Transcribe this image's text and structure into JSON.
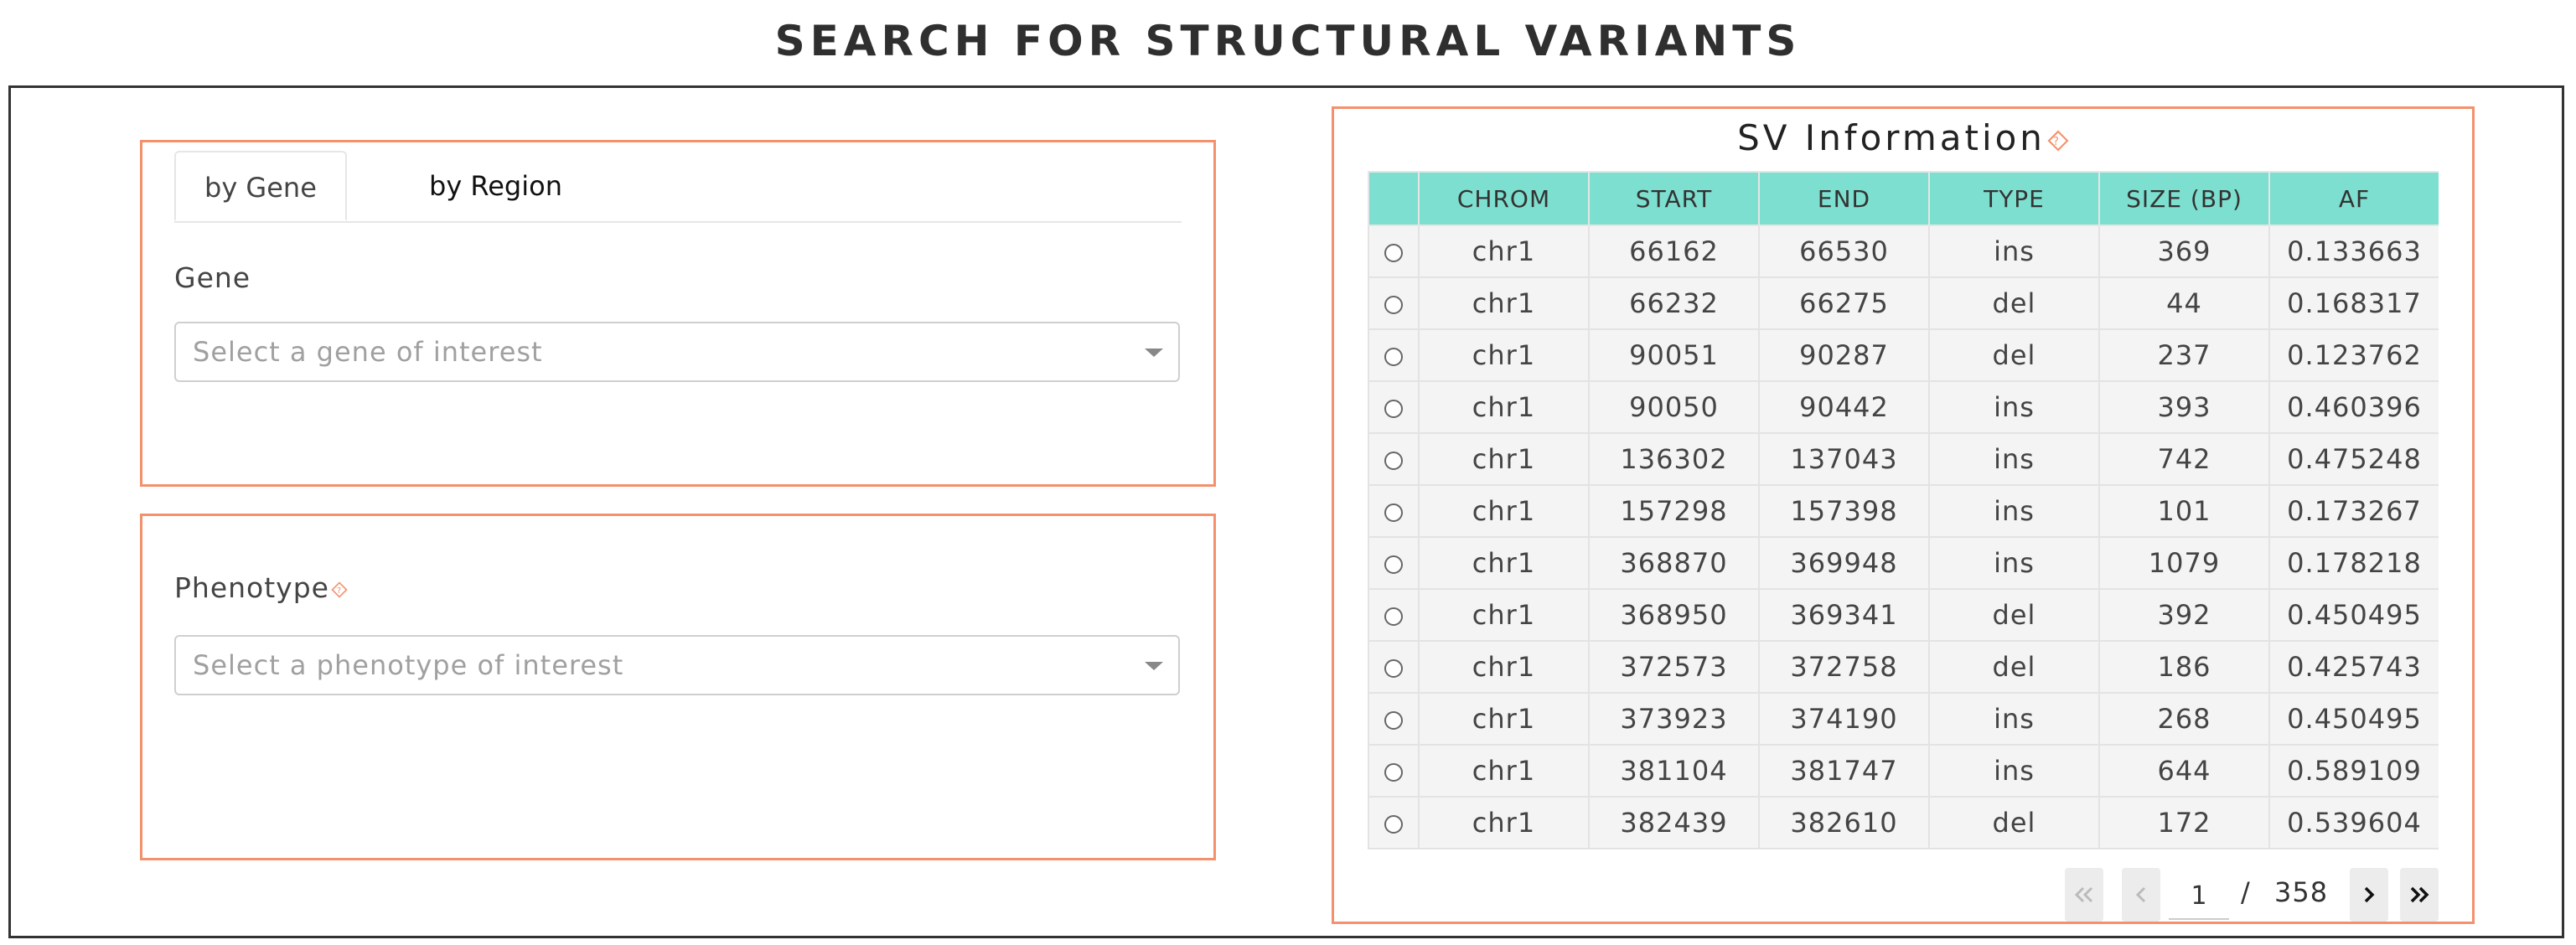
{
  "page": {
    "title": "SEARCH FOR STRUCTURAL VARIANTS"
  },
  "search": {
    "tabs": [
      {
        "label": "by Gene",
        "active": true
      },
      {
        "label": "by Region",
        "active": false
      }
    ],
    "gene_label": "Gene",
    "gene_placeholder": "Select a gene of interest",
    "phenotype_label": "Phenotype",
    "phenotype_placeholder": "Select a phenotype of interest"
  },
  "sv": {
    "title": "SV Information",
    "columns": [
      "CHROM",
      "START",
      "END",
      "TYPE",
      "SIZE (BP)",
      "AF"
    ],
    "rows": [
      [
        "chr1",
        "66162",
        "66530",
        "ins",
        "369",
        "0.133663"
      ],
      [
        "chr1",
        "66232",
        "66275",
        "del",
        "44",
        "0.168317"
      ],
      [
        "chr1",
        "90051",
        "90287",
        "del",
        "237",
        "0.123762"
      ],
      [
        "chr1",
        "90050",
        "90442",
        "ins",
        "393",
        "0.460396"
      ],
      [
        "chr1",
        "136302",
        "137043",
        "ins",
        "742",
        "0.475248"
      ],
      [
        "chr1",
        "157298",
        "157398",
        "ins",
        "101",
        "0.173267"
      ],
      [
        "chr1",
        "368870",
        "369948",
        "ins",
        "1079",
        "0.178218"
      ],
      [
        "chr1",
        "368950",
        "369341",
        "del",
        "392",
        "0.450495"
      ],
      [
        "chr1",
        "372573",
        "372758",
        "del",
        "186",
        "0.425743"
      ],
      [
        "chr1",
        "373923",
        "374190",
        "ins",
        "268",
        "0.450495"
      ],
      [
        "chr1",
        "381104",
        "381747",
        "ins",
        "644",
        "0.589109"
      ],
      [
        "chr1",
        "382439",
        "382610",
        "del",
        "172",
        "0.539604"
      ]
    ],
    "pagination": {
      "current_page": "1",
      "separator": "/",
      "total_pages": "358"
    }
  },
  "icons": {
    "help": "help-icon",
    "dropdown": "chevron-down-icon",
    "first": "double-chevron-left-icon",
    "prev": "chevron-left-icon",
    "next": "chevron-right-icon",
    "last": "double-chevron-right-icon"
  },
  "colors": {
    "accent": "#f4916c",
    "table_header": "#7ddfcf"
  }
}
